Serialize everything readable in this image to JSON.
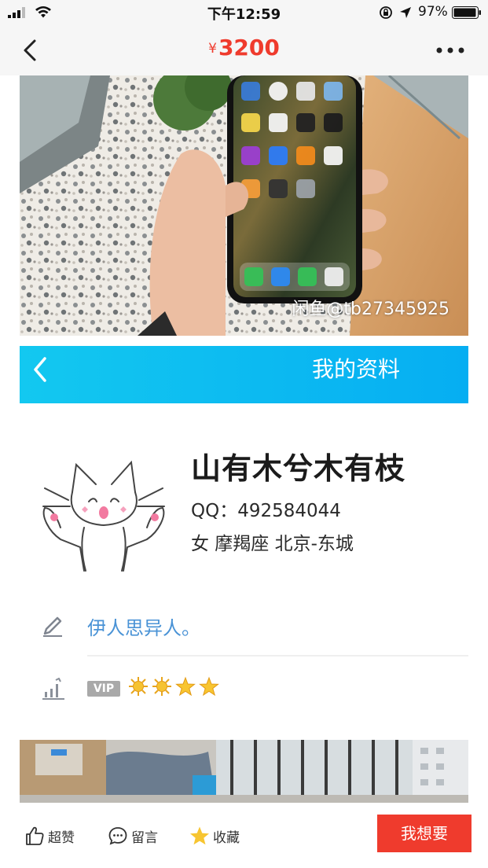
{
  "status_bar": {
    "time": "下午12:59",
    "battery": "97%"
  },
  "nav": {
    "currency": "¥",
    "price": "3200"
  },
  "photo1": {
    "watermark": "闲鱼@tb27345925"
  },
  "profile": {
    "header_title": "我的资料",
    "nickname": "山有木兮木有枝",
    "qq": "QQ：492584044",
    "meta": "女  摩羯座  北京-东城",
    "bio": "伊人思异人。",
    "vip_label": "VIP",
    "level_icons": [
      "sun-icon",
      "sun-icon",
      "star-icon",
      "star-icon"
    ]
  },
  "bottom_bar": {
    "like_label": "超赞",
    "comment_label": "留言",
    "favorite_label": "收藏",
    "want_label": "我想要"
  },
  "colors": {
    "accent": "#ef3b2d",
    "profile_header": "#0fbdf0",
    "bio_text": "#4a93d6"
  }
}
